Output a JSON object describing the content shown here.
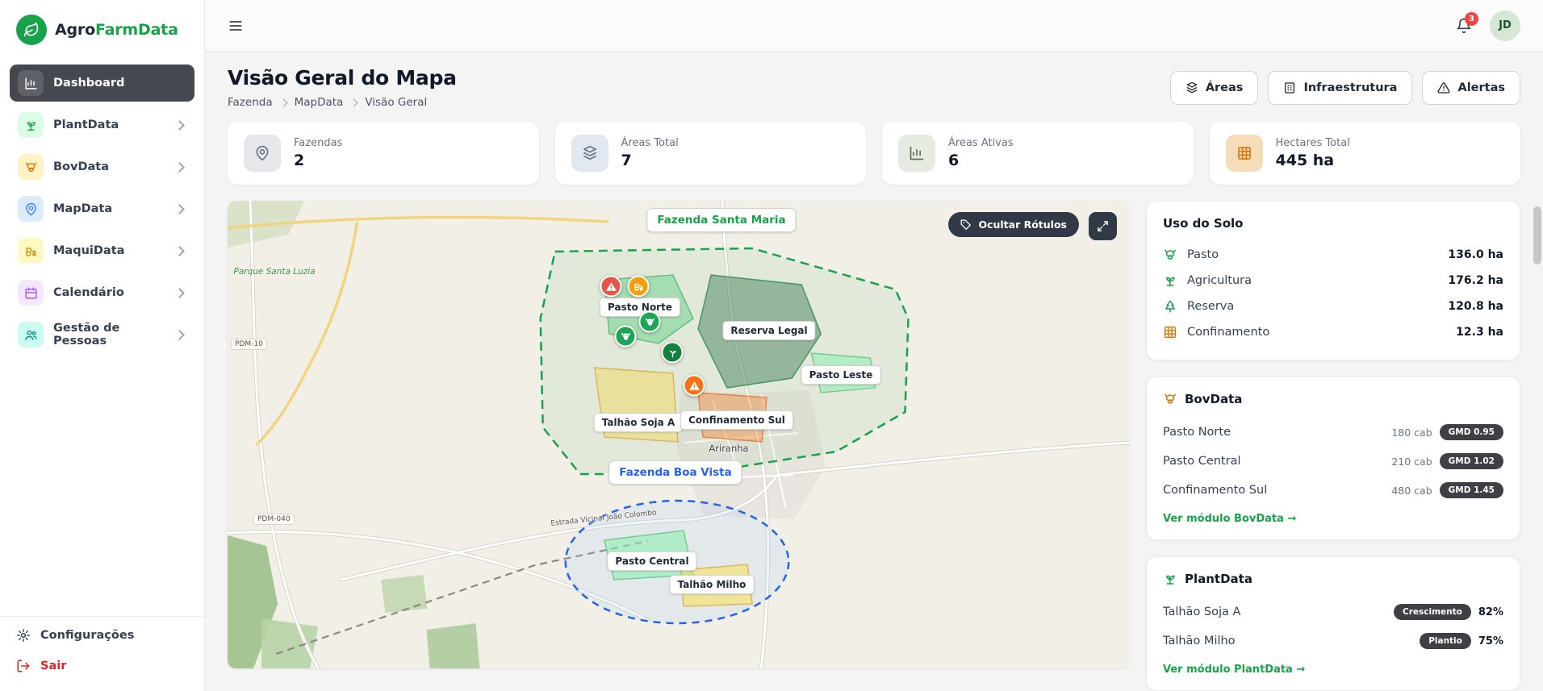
{
  "brand": {
    "name_primary": "Agro",
    "name_secondary": "FarmData"
  },
  "topbar": {
    "notification_count": "3",
    "avatar_initials": "JD"
  },
  "sidebar": {
    "items": [
      {
        "label": "Dashboard",
        "active": true
      },
      {
        "label": "PlantData"
      },
      {
        "label": "BovData"
      },
      {
        "label": "MapData"
      },
      {
        "label": "MaquiData"
      },
      {
        "label": "Calendário"
      },
      {
        "label": "Gestão de Pessoas"
      }
    ],
    "footer": {
      "settings": "Configurações",
      "logout": "Sair"
    }
  },
  "header": {
    "title": "Visão Geral do Mapa",
    "breadcrumb": [
      "Fazenda",
      "MapData",
      "Visão Geral"
    ],
    "actions": [
      "Áreas",
      "Infraestrutura",
      "Alertas"
    ]
  },
  "stats": [
    {
      "label": "Fazendas",
      "value": "2"
    },
    {
      "label": "Áreas Total",
      "value": "7"
    },
    {
      "label": "Áreas Ativas",
      "value": "6"
    },
    {
      "label": "Hectares Total",
      "value": "445 ha"
    }
  ],
  "map": {
    "toggle_labels_button": "Ocultar Rótulos",
    "labels": {
      "farm1": "Fazenda Santa Maria",
      "farm2": "Fazenda Boa Vista",
      "areas": [
        "Pasto Norte",
        "Reserva Legal",
        "Pasto Leste",
        "Talhão Soja A",
        "Confinamento Sul",
        "Pasto Central",
        "Talhão Milho"
      ],
      "town": "Ariranha",
      "park": "Parque Santa Luzia",
      "roads": [
        "PDM-10",
        "PDM-040",
        "Estrada Vicinal João Colombo"
      ]
    }
  },
  "panels": {
    "uso_solo": {
      "title": "Uso do Solo",
      "rows": [
        {
          "label": "Pasto",
          "value": "136.0 ha"
        },
        {
          "label": "Agricultura",
          "value": "176.2 ha"
        },
        {
          "label": "Reserva",
          "value": "120.8 ha"
        },
        {
          "label": "Confinamento",
          "value": "12.3 ha"
        }
      ]
    },
    "bovdata": {
      "title": "BovData",
      "rows": [
        {
          "label": "Pasto Norte",
          "count": "180 cab",
          "badge": "GMD 0.95"
        },
        {
          "label": "Pasto Central",
          "count": "210 cab",
          "badge": "GMD 1.02"
        },
        {
          "label": "Confinamento Sul",
          "count": "480 cab",
          "badge": "GMD 1.45"
        }
      ],
      "link": "Ver módulo BovData →"
    },
    "plantdata": {
      "title": "PlantData",
      "rows": [
        {
          "label": "Talhão Soja A",
          "badge": "Crescimento",
          "value": "82%"
        },
        {
          "label": "Talhão Milho",
          "badge": "Plantio",
          "value": "75%"
        }
      ],
      "link": "Ver módulo PlantData →"
    }
  },
  "colors": {
    "brand_green": "#16a34a",
    "active_nav": "#45484e",
    "badge_dark": "#3f3f46",
    "alert_red": "#ef4444",
    "bov_orange": "#d97706",
    "map_blue": "#2563eb"
  }
}
